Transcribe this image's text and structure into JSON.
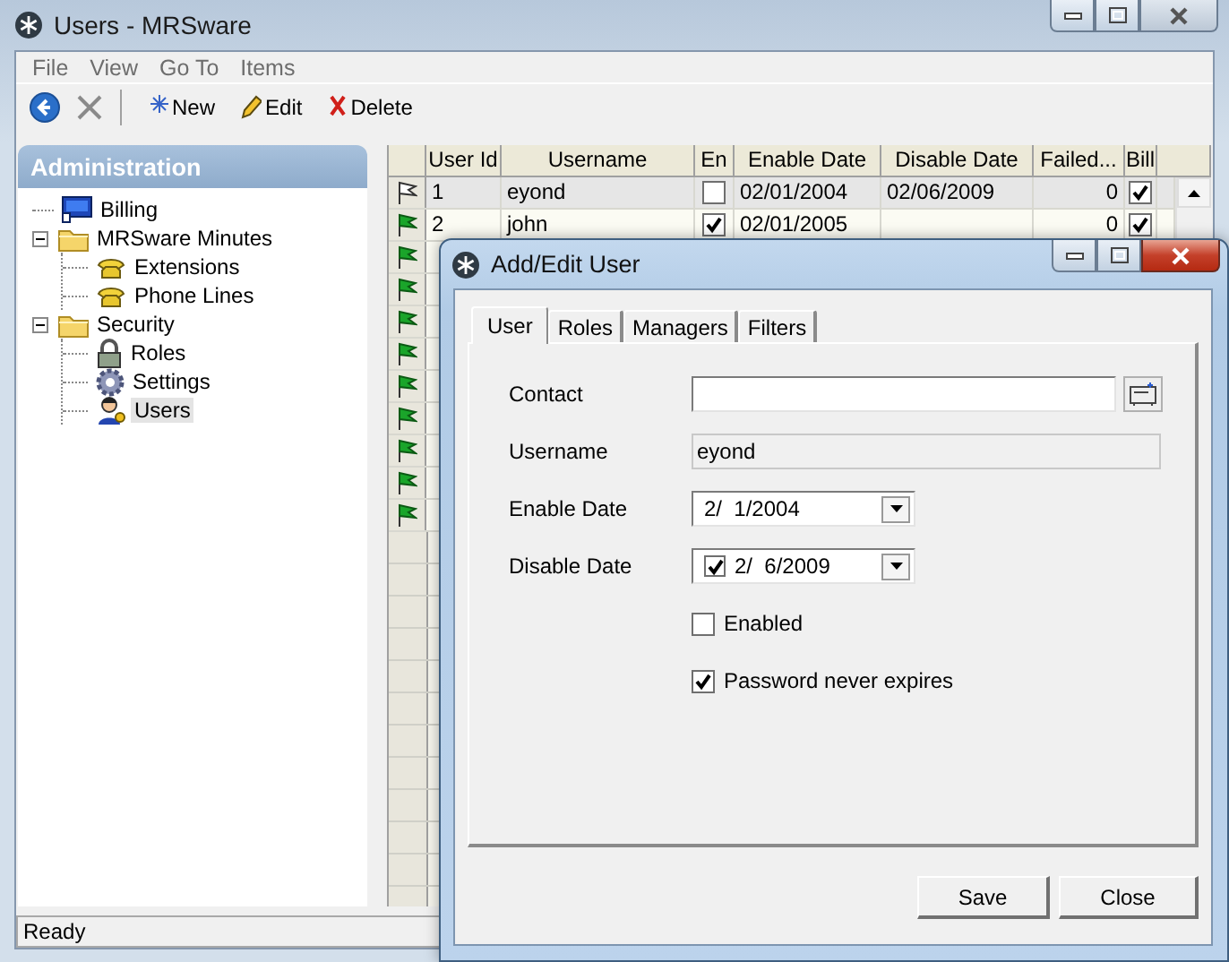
{
  "window": {
    "title": "Users - MRSware"
  },
  "menu": [
    "File",
    "View",
    "Go To",
    "Items"
  ],
  "toolbar": [
    {
      "kind": "new",
      "label": "New"
    },
    {
      "kind": "edit",
      "label": "Edit"
    },
    {
      "kind": "delete",
      "label": "Delete"
    }
  ],
  "sidebar": {
    "title": "Administration",
    "tree": [
      {
        "kind": "billing",
        "label": "Billing",
        "selected": false
      },
      {
        "kind": "folder",
        "label": "MRSware Minutes",
        "selected": false,
        "expanded": true,
        "children": [
          {
            "kind": "phone",
            "label": "Extensions",
            "selected": false
          },
          {
            "kind": "phone",
            "label": "Phone Lines",
            "selected": false
          }
        ]
      },
      {
        "kind": "folder",
        "label": "Security",
        "selected": false,
        "expanded": true,
        "children": [
          {
            "kind": "lock",
            "label": "Roles",
            "selected": false
          },
          {
            "kind": "gear",
            "label": "Settings",
            "selected": false
          },
          {
            "kind": "users",
            "label": "Users",
            "selected": true
          }
        ]
      }
    ]
  },
  "table": {
    "columns": [
      "User Id",
      "Username",
      "En",
      "Enable Date",
      "Disable Date",
      "Failed...",
      "Bill"
    ],
    "rows": [
      {
        "selected": true,
        "user_id": "1",
        "username": "eyond",
        "enabled": false,
        "enable_date": "02/01/2004",
        "disable_date": "02/06/2009",
        "failed": "0",
        "bill": true
      },
      {
        "selected": false,
        "user_id": "2",
        "username": "john",
        "enabled": true,
        "enable_date": "02/01/2005",
        "failed": "0",
        "bill": true
      },
      {
        "selected": false
      },
      {
        "selected": false
      },
      {
        "selected": false
      },
      {
        "selected": false
      },
      {
        "selected": false
      },
      {
        "selected": false
      },
      {
        "selected": false
      },
      {
        "selected": false
      },
      {
        "selected": false
      }
    ]
  },
  "status_bar": "Ready",
  "dialog": {
    "title": "Add/Edit User",
    "tabs": [
      {
        "label": "User",
        "selected": true
      },
      {
        "label": "Roles",
        "selected": false
      },
      {
        "label": "Managers",
        "selected": false
      },
      {
        "label": "Filters",
        "selected": false
      }
    ],
    "fields": [
      {
        "kind": "lookup",
        "label": "Contact",
        "disabled": false
      },
      {
        "kind": "text",
        "label": "Username",
        "value": "eyond",
        "disabled": true
      },
      {
        "kind": "date",
        "label": "Enable Date",
        "value": "2/  1/2004",
        "disabled": false
      },
      {
        "kind": "date",
        "label": "Disable Date",
        "value": "2/  6/2009",
        "checked": true,
        "disabled": false
      }
    ],
    "checkboxes": [
      {
        "label": "Enabled",
        "checked": false
      },
      {
        "label": "Password never expires",
        "checked": true
      }
    ],
    "buttons": [
      "Save",
      "Close"
    ]
  }
}
